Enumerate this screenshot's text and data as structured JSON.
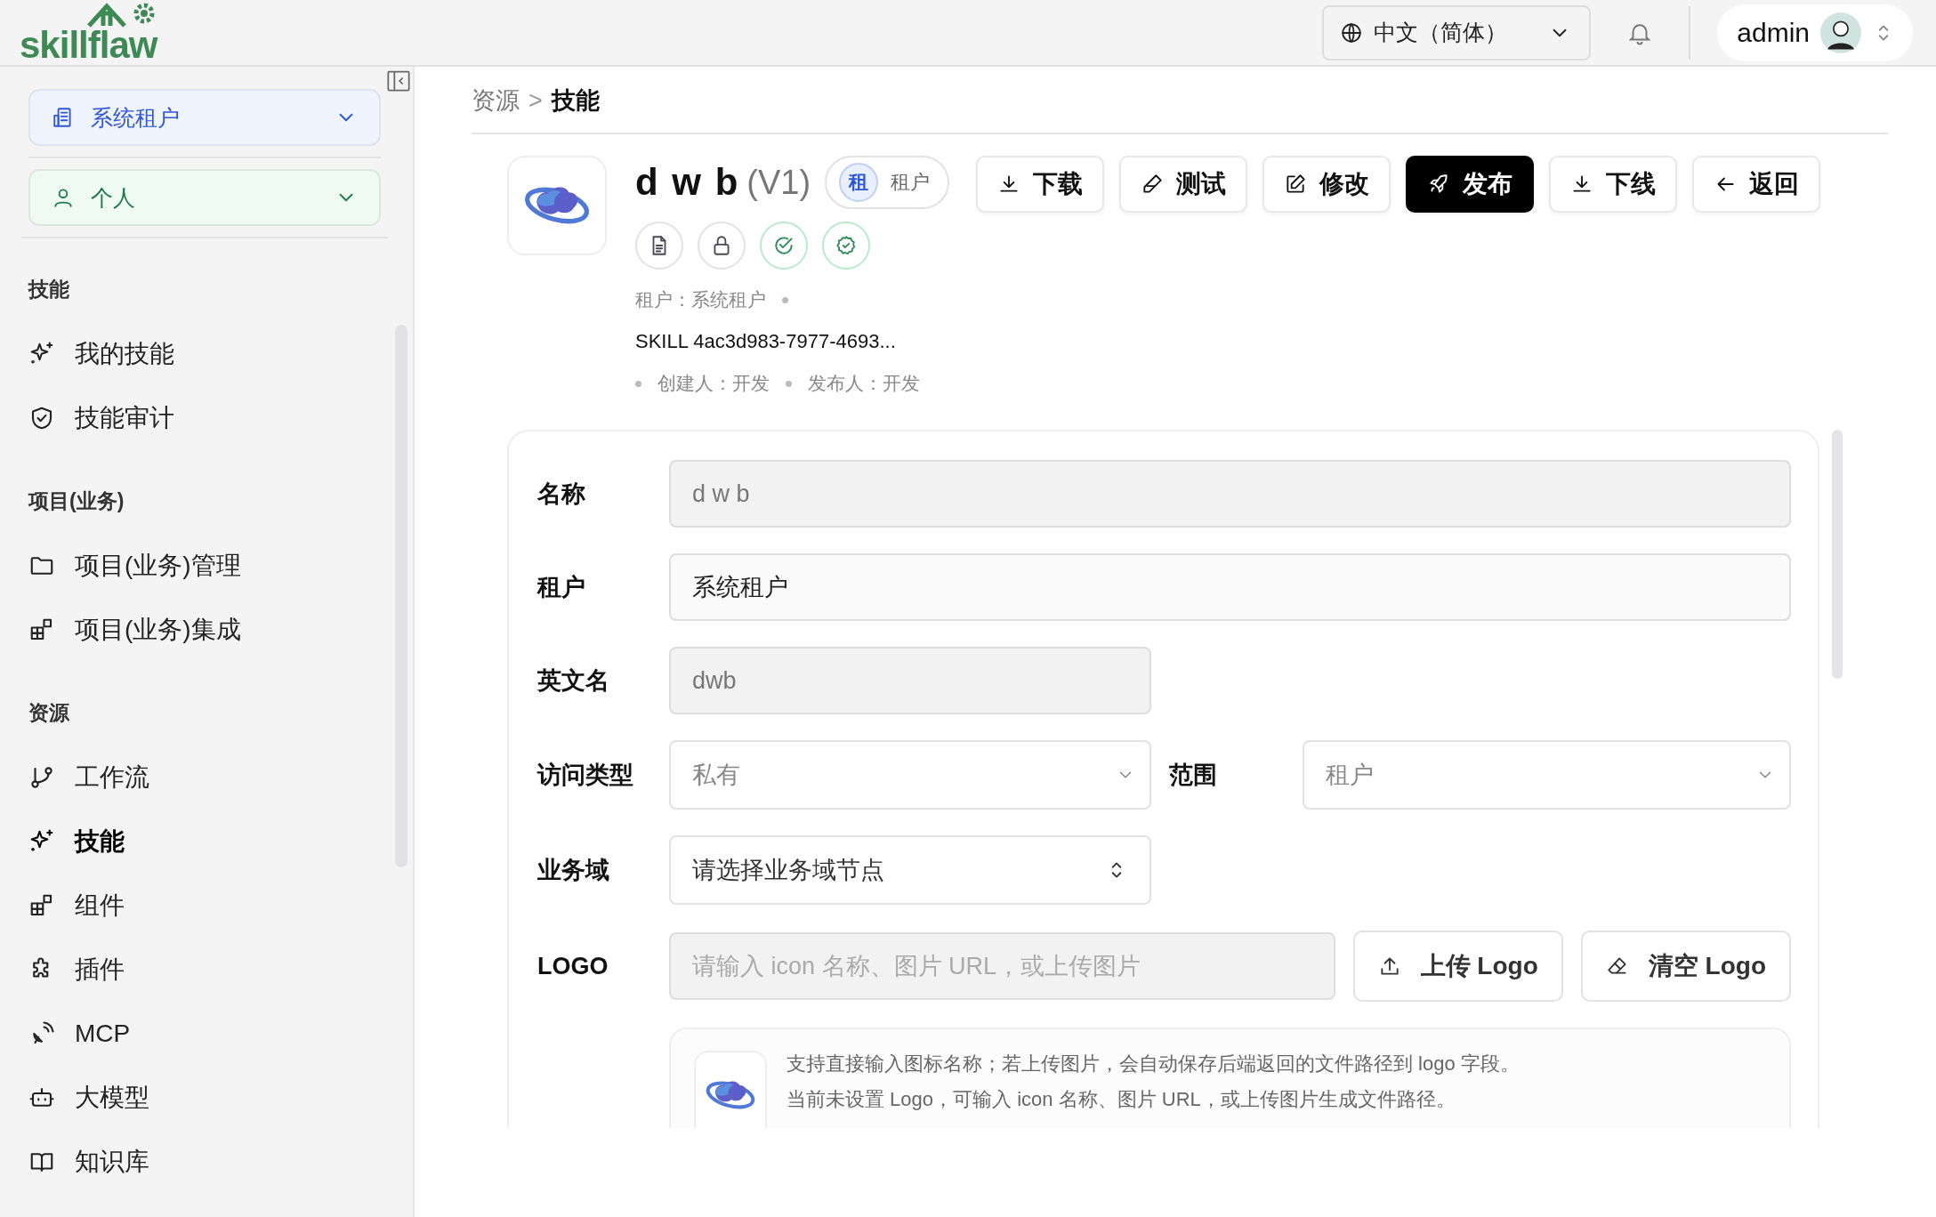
{
  "brand": {
    "name": "skillflaw"
  },
  "topbar": {
    "language": "中文（简体）",
    "user": "admin"
  },
  "sidebar": {
    "tenant_select": "系统租户",
    "scope_select": "个人",
    "sections": [
      {
        "title": "技能",
        "items": [
          {
            "label": "我的技能",
            "kind": "sparkle",
            "selected": false
          },
          {
            "label": "技能审计",
            "kind": "shield",
            "selected": false
          }
        ]
      },
      {
        "title": "项目(业务)",
        "items": [
          {
            "label": "项目(业务)管理",
            "kind": "folder",
            "selected": false
          },
          {
            "label": "项目(业务)集成",
            "kind": "blocks",
            "selected": false
          }
        ]
      },
      {
        "title": "资源",
        "items": [
          {
            "label": "工作流",
            "kind": "branch",
            "selected": false
          },
          {
            "label": "技能",
            "kind": "sparkle",
            "selected": true
          },
          {
            "label": "组件",
            "kind": "blocks",
            "selected": false
          },
          {
            "label": "插件",
            "kind": "puzzle",
            "selected": false
          },
          {
            "label": "MCP",
            "kind": "satellite",
            "selected": false
          },
          {
            "label": "大模型",
            "kind": "robot",
            "selected": false
          },
          {
            "label": "知识库",
            "kind": "book",
            "selected": false
          }
        ]
      }
    ]
  },
  "breadcrumb": {
    "items": [
      "资源",
      "技能"
    ],
    "separator": ">"
  },
  "skill": {
    "name": "d w b",
    "version": "(V1)",
    "badge_mark": "租",
    "badge_label": "租户",
    "status_icons": [
      {
        "kind": "document"
      },
      {
        "kind": "lock"
      },
      {
        "kind": "check"
      },
      {
        "kind": "verified"
      }
    ],
    "tenant_line": "租户：系统租户",
    "id": "SKILL 4ac3d983-7977-4693...",
    "creator": "创建人：开发",
    "publisher": "发布人：开发"
  },
  "actions": [
    {
      "label": "下载",
      "kind": "download",
      "primary": false
    },
    {
      "label": "测试",
      "kind": "pen",
      "primary": false
    },
    {
      "label": "修改",
      "kind": "edit",
      "primary": false
    },
    {
      "label": "发布",
      "kind": "rocket",
      "primary": true
    },
    {
      "label": "下线",
      "kind": "download",
      "primary": false
    },
    {
      "label": "返回",
      "kind": "back",
      "primary": false
    }
  ],
  "form": {
    "fields": [
      {
        "label": "名称",
        "value": "d w b",
        "readonly": true,
        "wide": true
      },
      {
        "label": "租户",
        "value": "系统租户",
        "readonly": false,
        "wide": true
      },
      {
        "label": "英文名",
        "value": "dwb",
        "readonly": true,
        "wide": false
      }
    ],
    "access_type": {
      "label": "访问类型",
      "value": "私有",
      "disabled": true
    },
    "scope": {
      "label": "范围",
      "value": "租户",
      "disabled": true
    },
    "business_domain": {
      "label": "业务域",
      "placeholder": "请选择业务域节点"
    },
    "logo": {
      "label": "LOGO",
      "placeholder": "请输入 icon 名称、图片 URL，或上传图片",
      "upload": "上传 Logo",
      "clear": "清空 Logo",
      "hints": [
        "支持直接输入图标名称；若上传图片，会自动保存后端返回的文件路径到 logo 字段。",
        "当前未设置 Logo，可输入 icon 名称、图片 URL，或上传图片生成文件路径。"
      ]
    }
  }
}
